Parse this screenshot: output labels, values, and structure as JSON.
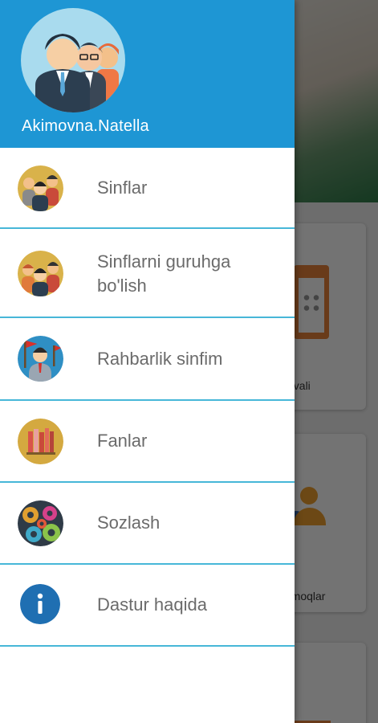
{
  "user": {
    "name": "Akimovna.Natella"
  },
  "menu": {
    "items": [
      {
        "label": "Sinflar",
        "icon": "class-group-icon"
      },
      {
        "label": "Sinflarni guruhga bo'lish",
        "icon": "split-groups-icon"
      },
      {
        "label": "Rahbarlik sinfim",
        "icon": "leader-class-icon"
      },
      {
        "label": "Fanlar",
        "icon": "books-icon"
      },
      {
        "label": "Sozlash",
        "icon": "settings-gears-icon"
      },
      {
        "label": "Dastur haqida",
        "icon": "info-icon"
      }
    ]
  },
  "background": {
    "card1_label": "dvali",
    "card2_label": "rmoqlar"
  },
  "colors": {
    "header": "#1e96d4",
    "divider": "#47b7d8",
    "text": "#6b6b6b"
  }
}
